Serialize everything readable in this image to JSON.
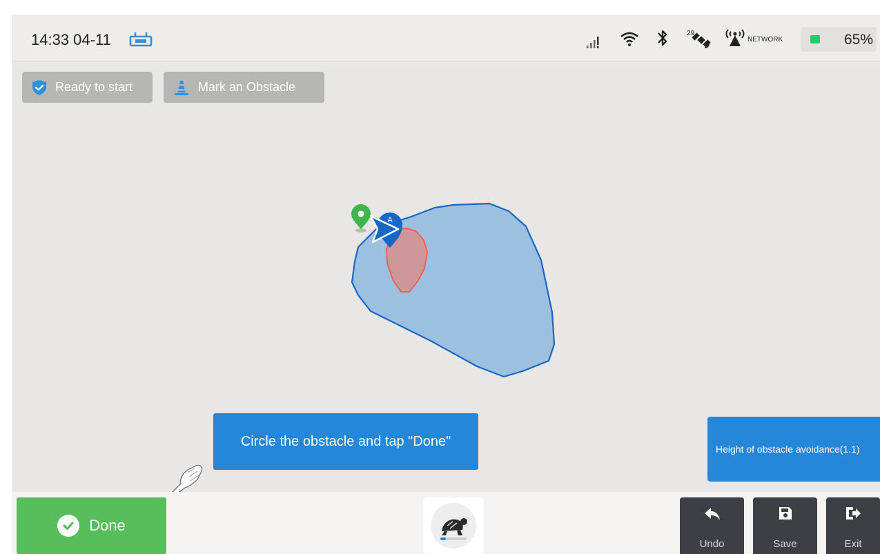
{
  "status_bar": {
    "clock": "14:33 04-11",
    "satellite_count": "29",
    "network_label": "NETWORK",
    "battery_percent": "65%",
    "battery_level": 0.65,
    "icons": [
      "remote-controller-icon",
      "cellular-signal-icon",
      "wifi-icon",
      "bluetooth-icon",
      "satellite-icon",
      "network-antenna-icon",
      "battery-icon"
    ]
  },
  "top_pills": {
    "ready_label": "Ready to start",
    "obstacle_label": "Mark an Obstacle"
  },
  "tooltips": {
    "instruction": "Circle the obstacle and tap \"Done\"",
    "height_avoidance": "Height of obstacle avoidance(1.1)"
  },
  "bottom_bar": {
    "done_label": "Done",
    "undo_label": "Undo",
    "save_label": "Save",
    "exit_label": "Exit",
    "speed_mode_icon": "turtle-slow-mode-icon"
  },
  "colors": {
    "accent_blue": "#2587d9",
    "done_green": "#58be5b",
    "field_fill": "#9dbfe0",
    "field_stroke": "#1767c4",
    "obstacle_fill": "#d98f8d",
    "obstacle_stroke": "#ee5c4f",
    "action_dark": "#3c3f43"
  }
}
